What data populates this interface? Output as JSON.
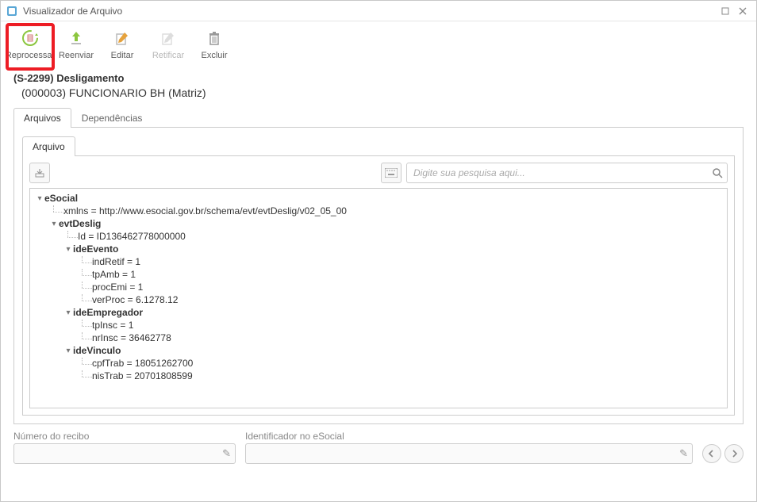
{
  "window": {
    "title": "Visualizador de Arquivo"
  },
  "toolbar": {
    "reprocessar": "Reprocessar",
    "reenviar": "Reenviar",
    "editar": "Editar",
    "retificar": "Retificar",
    "excluir": "Excluir"
  },
  "event": {
    "title": "(S-2299) Desligamento",
    "subtitle": "(000003) FUNCIONARIO BH (Matriz)"
  },
  "tabs": {
    "outer": [
      "Arquivos",
      "Dependências"
    ],
    "inner": [
      "Arquivo"
    ]
  },
  "search": {
    "placeholder": "Digite sua pesquisa aqui..."
  },
  "tree": {
    "root": "eSocial",
    "xmlns": "xmlns = http://www.esocial.gov.br/schema/evt/evtDeslig/v02_05_00",
    "evtDeslig": "evtDeslig",
    "id": "Id = ID136462778000000",
    "ideEvento": "ideEvento",
    "indRetif": "indRetif = 1",
    "tpAmb": "tpAmb = 1",
    "procEmi": "procEmi = 1",
    "verProc": "verProc = 6.1278.12",
    "ideEmpregador": "ideEmpregador",
    "tpInsc": "tpInsc = 1",
    "nrInsc": "nrInsc = 36462778",
    "ideVinculo": "ideVinculo",
    "cpfTrab": "cpfTrab = 18051262700",
    "nisTrab": "nisTrab = 20701808599"
  },
  "footer": {
    "recibo_label": "Número do recibo",
    "ident_label": "Identificador no eSocial"
  }
}
